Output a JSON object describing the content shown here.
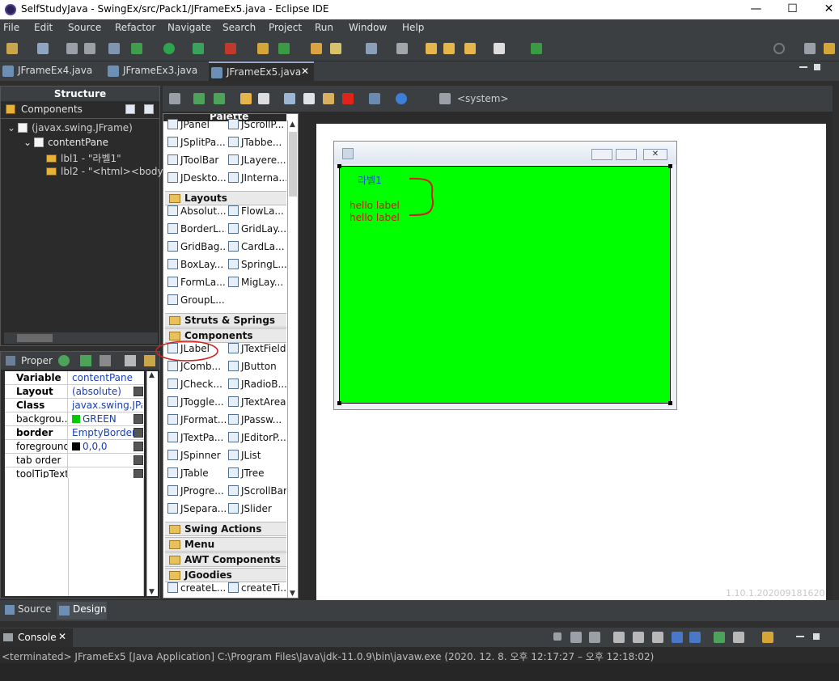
{
  "window": {
    "title": "SelfStudyJava - SwingEx/src/Pack1/JFrameEx5.java - Eclipse IDE",
    "minimize": "—",
    "maximize": "☐",
    "close": "✕"
  },
  "menu": [
    "File",
    "Edit",
    "Source",
    "Refactor",
    "Navigate",
    "Search",
    "Project",
    "Run",
    "Window",
    "Help"
  ],
  "editor_tabs": [
    {
      "label": "JFrameEx4.java"
    },
    {
      "label": "JFrameEx3.java"
    },
    {
      "label": "JFrameEx5.java",
      "close": "✕"
    }
  ],
  "structure": {
    "title": "Structure",
    "components_label": "Components",
    "tree": [
      "(javax.swing.JFrame)",
      "contentPane",
      "lbl1 - \"라벨1\"",
      "lbl2 - \"<html><body>"
    ]
  },
  "properties": {
    "title": "Proper",
    "rows": [
      {
        "name": "Variable",
        "value": "contentPane",
        "bold": true
      },
      {
        "name": "Layout",
        "value": "(absolute)",
        "bold": true,
        "button": true
      },
      {
        "name": "Class",
        "value": "javax.swing.JPa...",
        "bold": true
      },
      {
        "name": "backgrou...",
        "value": "GREEN",
        "swatch": "#00cc00",
        "button": true
      },
      {
        "name": "border",
        "value": "EmptyBorder",
        "bold": true,
        "button": true
      },
      {
        "name": "foreground",
        "value": "0,0,0",
        "swatch": "#000000",
        "button": true
      },
      {
        "name": "tab order",
        "value": "",
        "button": true
      },
      {
        "name": "toolTipText",
        "value": "",
        "button": true
      }
    ]
  },
  "designer_toolbar": {
    "system_label": "<system>"
  },
  "palette": {
    "title": "Palette",
    "rows1": [
      [
        "JPanel",
        "JScrollP..."
      ],
      [
        "JSplitPa...",
        "JTabbe..."
      ],
      [
        "JToolBar",
        "JLayere..."
      ],
      [
        "JDeskto...",
        "JInterna..."
      ]
    ],
    "cat_layouts": "Layouts",
    "rows2": [
      [
        "Absolut...",
        "FlowLa..."
      ],
      [
        "BorderL...",
        "GridLay..."
      ],
      [
        "GridBag...",
        "CardLa..."
      ],
      [
        "BoxLay...",
        "SpringL..."
      ],
      [
        "FormLa...",
        "MigLay..."
      ],
      [
        "GroupL...",
        ""
      ]
    ],
    "cat_struts": "Struts & Springs",
    "cat_components": "Components",
    "rows3": [
      [
        "JLabel",
        "JTextField"
      ],
      [
        "JComb...",
        "JButton"
      ],
      [
        "JCheck...",
        "JRadioB..."
      ],
      [
        "JToggle...",
        "JTextArea"
      ],
      [
        "JFormat...",
        "JPassw..."
      ],
      [
        "JTextPa...",
        "JEditorP..."
      ],
      [
        "JSpinner",
        "JList"
      ],
      [
        "JTable",
        "JTree"
      ],
      [
        "JProgre...",
        "JScrollBar"
      ],
      [
        "JSepara...",
        "JSlider"
      ]
    ],
    "cat_swing_actions": "Swing Actions",
    "cat_menu": "Menu",
    "cat_awt": "AWT Components",
    "cat_jgoodies": "JGoodies",
    "rows4": [
      [
        "createL...",
        "createTi..."
      ]
    ]
  },
  "frame_content": {
    "lbl1": "라벨1",
    "lbl2_line1": "hello label",
    "lbl2_line2": "hello label",
    "background": "#00ff00"
  },
  "version": "1.10.1.202009181620",
  "bottom_tabs": [
    "Source",
    "Design"
  ],
  "console": {
    "tab": "Console",
    "close": "✕",
    "status": "<terminated> JFrameEx5 [Java Application] C:\\Program Files\\Java\\jdk-11.0.9\\bin\\javaw.exe  (2020. 12. 8. 오후 12:17:27 – 오후 12:18:02)"
  }
}
